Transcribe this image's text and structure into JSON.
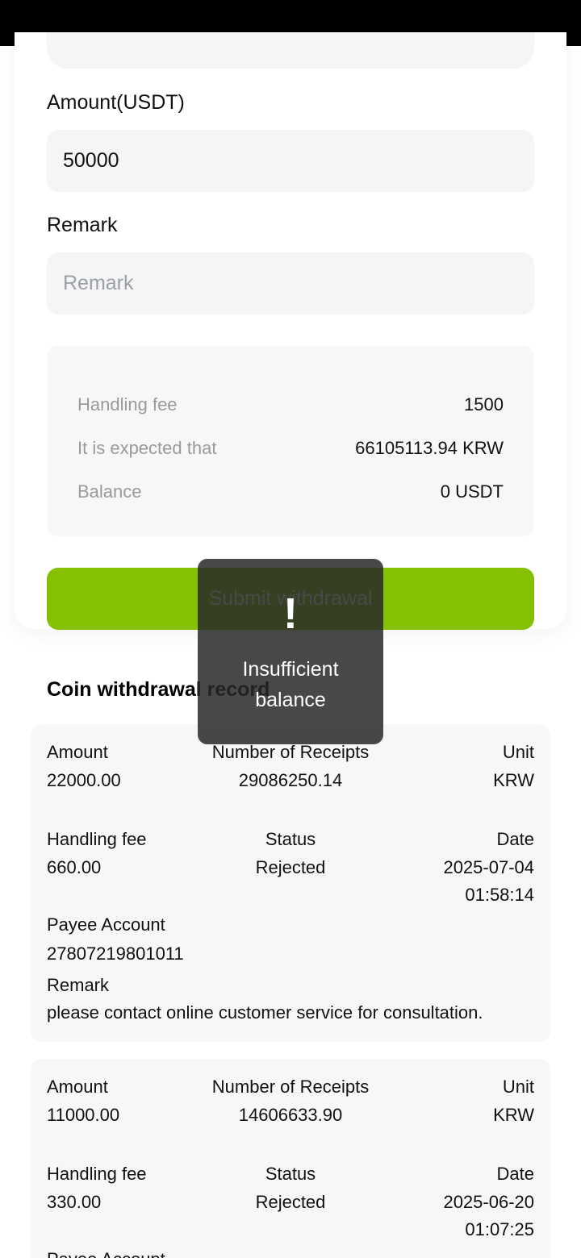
{
  "form": {
    "amount_label": "Amount(USDT)",
    "amount_value": "50000",
    "remark_label": "Remark",
    "remark_placeholder": "Remark",
    "summary": [
      {
        "key": "Handling fee",
        "value": "1500"
      },
      {
        "key": "It is expected that",
        "value": "66105113.94 KRW"
      },
      {
        "key": "Balance",
        "value": "0 USDT"
      }
    ],
    "submit_label": "Submit withdrawal"
  },
  "records_title": "Coin withdrawal record",
  "records": [
    {
      "amount_label": "Amount",
      "amount": "22000.00",
      "receipts_label": "Number of Receipts",
      "receipts": "29086250.14",
      "unit_label": "Unit",
      "unit": "KRW",
      "fee_label": "Handling fee",
      "fee": "660.00",
      "status_label": "Status",
      "status": "Rejected",
      "date_label": "Date",
      "date": "2025-07-04 01:58:14",
      "payee_label": "Payee Account",
      "payee": "27807219801011",
      "remark_label": "Remark",
      "remark": "please contact online customer service for consultation."
    },
    {
      "amount_label": "Amount",
      "amount": "11000.00",
      "receipts_label": "Number of Receipts",
      "receipts": "14606633.90",
      "unit_label": "Unit",
      "unit": "KRW",
      "fee_label": "Handling fee",
      "fee": "330.00",
      "status_label": "Status",
      "status": "Rejected",
      "date_label": "Date",
      "date": "2025-06-20 01:07:25",
      "payee_label": "Payee Account"
    }
  ],
  "toast": {
    "icon": "exclamation-icon",
    "symbol": "!",
    "message": "Insufficient balance"
  }
}
